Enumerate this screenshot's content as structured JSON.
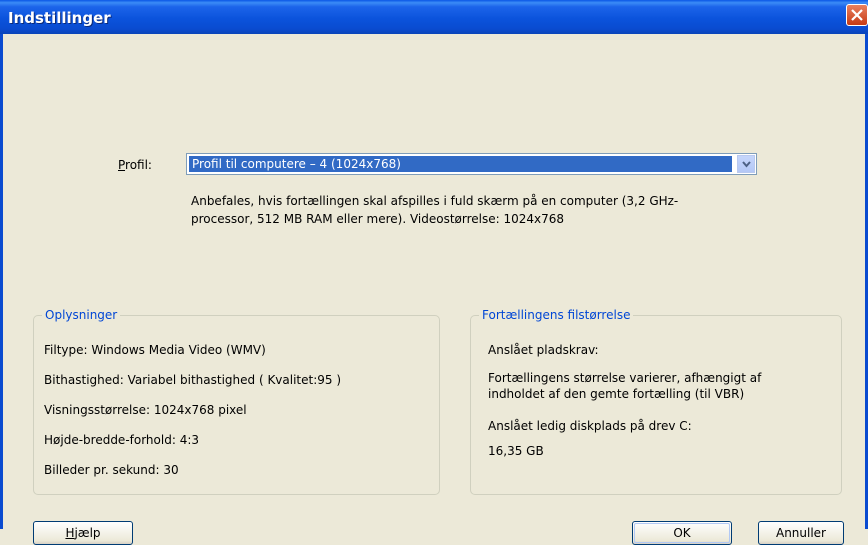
{
  "window": {
    "title": "Indstillinger"
  },
  "profile": {
    "label_accel": "P",
    "label_rest": "rofil:",
    "selected": "Profil til computere – 4 (1024x768)",
    "description": "Anbefales, hvis fortællingen skal afspilles i fuld skærm på en computer (3,2 GHz-processor, 512 MB RAM eller mere). Videostørrelse: 1024x768"
  },
  "info": {
    "title": "Oplysninger",
    "lines": [
      "Filtype:  Windows Media Video (WMV)",
      "Bithastighed:  Variabel bithastighed ( Kvalitet:95 )",
      "Visningsstørrelse:  1024x768 pixel",
      "Højde-bredde-forhold:  4:3",
      "Billeder pr. sekund:  30"
    ]
  },
  "filesize": {
    "title": "Fortællingens filstørrelse",
    "estimated_label": "Anslået pladskrav:",
    "size_note": "Fortællingens størrelse varierer, afhængigt af indholdet af den gemte fortælling (til VBR)",
    "disk_label": "Anslået ledig diskplads på drev C:",
    "disk_value": "16,35 GB"
  },
  "buttons": {
    "help_accel": "H",
    "help_rest": "jælp",
    "ok": "OK",
    "cancel": "Annuller"
  },
  "icons": {
    "close": "close-icon",
    "dropdown": "chevron-down-icon"
  }
}
